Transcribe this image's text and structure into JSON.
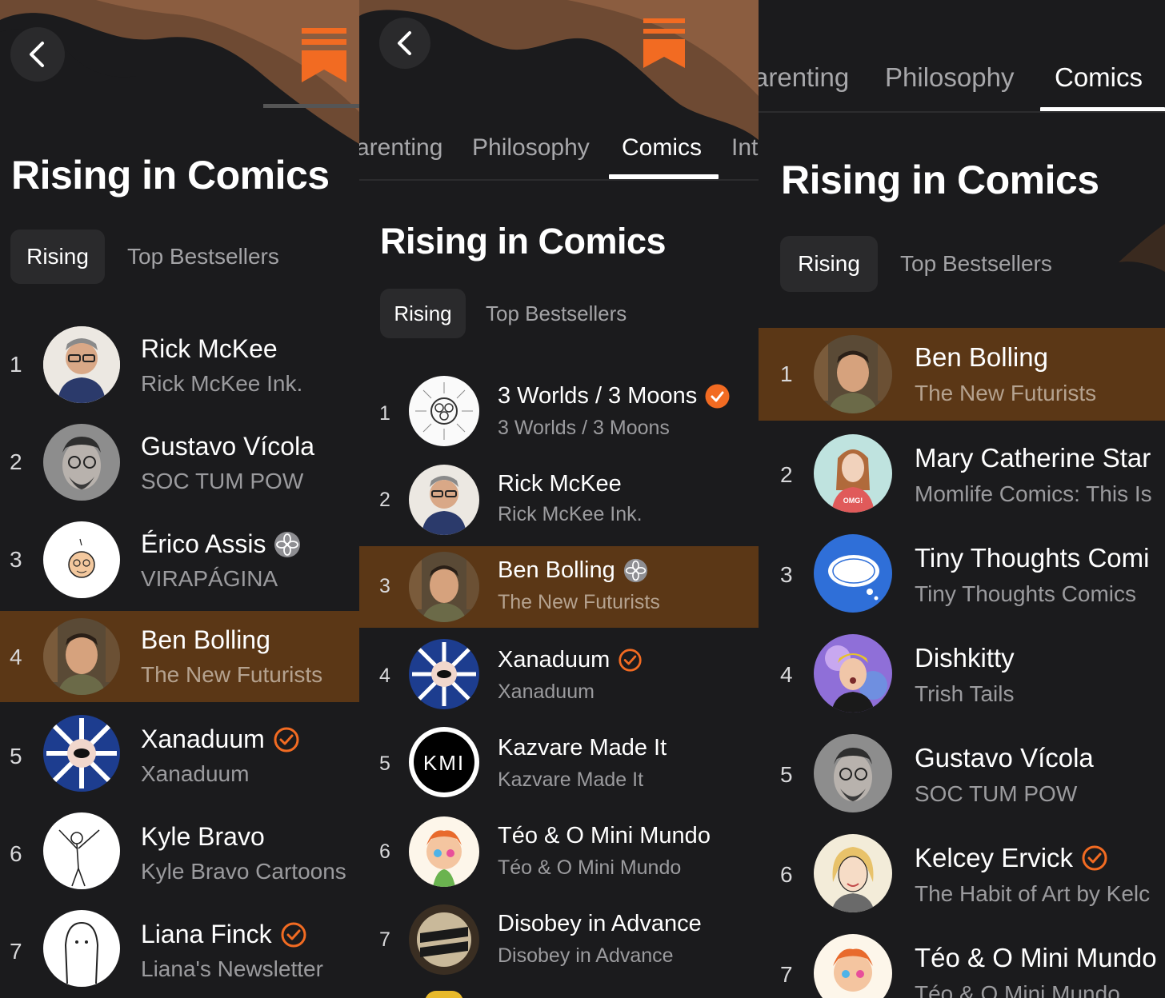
{
  "colors": {
    "background": "#1b1b1d",
    "highlight": "#5b3716",
    "accent": "#f26b22",
    "muted": "#9b9b9e"
  },
  "icons": {
    "back": "chevron-left-icon",
    "logo": "bookmark-logo",
    "verified": "check-circle-icon",
    "bestseller": "flower-badge-icon"
  },
  "left": {
    "title": "Rising in Comics",
    "segments": {
      "rising": "Rising",
      "top": "Top Bestsellers"
    },
    "rows": [
      {
        "rank": "1",
        "name": "Rick McKee",
        "sub": "Rick McKee Ink.",
        "badge": ""
      },
      {
        "rank": "2",
        "name": "Gustavo Vícola",
        "sub": "SOC TUM POW",
        "badge": ""
      },
      {
        "rank": "3",
        "name": "Érico Assis",
        "sub": "VIRAPÁGINA",
        "badge": "flower"
      },
      {
        "rank": "4",
        "name": "Ben Bolling",
        "sub": "The New Futurists",
        "badge": ""
      },
      {
        "rank": "5",
        "name": "Xanaduum",
        "sub": "Xanaduum",
        "badge": "check"
      },
      {
        "rank": "6",
        "name": "Kyle Bravo",
        "sub": "Kyle Bravo Cartoons",
        "badge": ""
      },
      {
        "rank": "7",
        "name": "Liana Finck",
        "sub": "Liana's Newsletter",
        "badge": "check"
      }
    ]
  },
  "middle": {
    "tabs": [
      "arenting",
      "Philosophy",
      "Comics",
      "Int"
    ],
    "title": "Rising in Comics",
    "segments": {
      "rising": "Rising",
      "top": "Top Bestsellers"
    },
    "rows": [
      {
        "rank": "1",
        "name": "3 Worlds / 3 Moons",
        "sub": "3 Worlds / 3 Moons",
        "badge": "check-filled"
      },
      {
        "rank": "2",
        "name": "Rick McKee",
        "sub": "Rick McKee Ink.",
        "badge": ""
      },
      {
        "rank": "3",
        "name": "Ben Bolling",
        "sub": "The New Futurists",
        "badge": "flower"
      },
      {
        "rank": "4",
        "name": "Xanaduum",
        "sub": "Xanaduum",
        "badge": "check"
      },
      {
        "rank": "5",
        "name": "Kazvare Made It",
        "sub": "Kazvare Made It",
        "badge": ""
      },
      {
        "rank": "6",
        "name": "Téo & O Mini Mundo",
        "sub": "Téo & O Mini Mundo",
        "badge": ""
      },
      {
        "rank": "7",
        "name": "Disobey in Advance",
        "sub": "Disobey in Advance",
        "badge": ""
      }
    ]
  },
  "right": {
    "tabs": [
      "arenting",
      "Philosophy",
      "Comics"
    ],
    "title": "Rising in Comics",
    "segments": {
      "rising": "Rising",
      "top": "Top Bestsellers"
    },
    "rows": [
      {
        "rank": "1",
        "name": "Ben Bolling",
        "sub": "The New Futurists",
        "badge": ""
      },
      {
        "rank": "2",
        "name": "Mary Catherine Star",
        "sub": "Momlife Comics: This Is",
        "badge": ""
      },
      {
        "rank": "3",
        "name": "Tiny Thoughts Comi",
        "sub": "Tiny Thoughts Comics",
        "badge": ""
      },
      {
        "rank": "4",
        "name": "Dishkitty",
        "sub": "Trish Tails",
        "badge": ""
      },
      {
        "rank": "5",
        "name": "Gustavo Vícola",
        "sub": "SOC TUM POW",
        "badge": ""
      },
      {
        "rank": "6",
        "name": "Kelcey Ervick",
        "sub": "The Habit of Art by Kelc",
        "badge": "check"
      },
      {
        "rank": "7",
        "name": "Téo & O Mini Mundo",
        "sub": "Téo & O Mini Mundo",
        "badge": ""
      }
    ]
  }
}
